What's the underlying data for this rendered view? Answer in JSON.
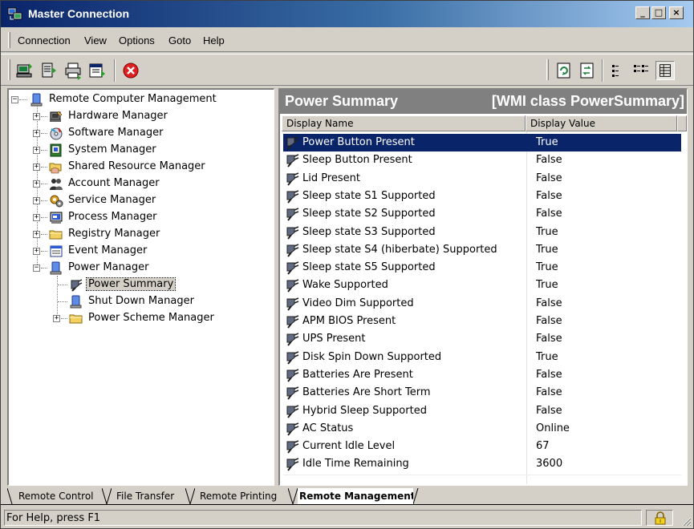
{
  "window": {
    "title": "Master Connection",
    "app_icon": "network-computer-icon",
    "controls": {
      "minimize": "_",
      "maximize": "□",
      "close": "×"
    }
  },
  "menubar": {
    "items": [
      "Connection",
      "View",
      "Options",
      "Goto",
      "Help"
    ]
  },
  "toolbar": {
    "left_buttons": [
      "connect-icon",
      "import-icon",
      "print-icon",
      "properties-icon",
      "stop-icon"
    ],
    "right_buttons": [
      "refresh-icon",
      "sync-icon",
      "small-icons-view-icon",
      "list-view-icon",
      "details-view-icon"
    ],
    "pressed": "details-view-icon"
  },
  "tree": {
    "root": {
      "label": "Remote Computer Management",
      "icon": "computer-icon"
    },
    "items": [
      {
        "label": "Hardware Manager",
        "icon": "hardware-icon"
      },
      {
        "label": "Software Manager",
        "icon": "software-icon"
      },
      {
        "label": "System Manager",
        "icon": "system-icon"
      },
      {
        "label": "Shared Resource Manager",
        "icon": "shared-folder-icon"
      },
      {
        "label": "Account Manager",
        "icon": "users-icon"
      },
      {
        "label": "Service Manager",
        "icon": "service-icon"
      },
      {
        "label": "Process Manager",
        "icon": "process-icon"
      },
      {
        "label": "Registry Manager",
        "icon": "folder-icon"
      },
      {
        "label": "Event Manager",
        "icon": "event-log-icon"
      },
      {
        "label": "Power Manager",
        "icon": "power-icon"
      }
    ],
    "power_children": [
      {
        "label": "Power Summary",
        "icon": "power-plug-icon",
        "selected": true
      },
      {
        "label": "Shut Down Manager",
        "icon": "shutdown-icon"
      },
      {
        "label": "Power Scheme Manager",
        "icon": "folder-icon"
      }
    ]
  },
  "panel": {
    "title": "Power Summary",
    "wmi_class": "[WMI class PowerSummary]",
    "columns": [
      "Display Name",
      "Display Value"
    ],
    "rows": [
      {
        "name": "Power Button Present",
        "value": "True"
      },
      {
        "name": "Sleep Button Present",
        "value": "False"
      },
      {
        "name": "Lid Present",
        "value": "False"
      },
      {
        "name": "Sleep state S1 Supported",
        "value": "False"
      },
      {
        "name": "Sleep state S2 Supported",
        "value": "False"
      },
      {
        "name": "Sleep state S3 Supported",
        "value": "True"
      },
      {
        "name": "Sleep state S4 (hiberbate) Supported",
        "value": "True"
      },
      {
        "name": "Sleep state S5 Supported",
        "value": "True"
      },
      {
        "name": "Wake Supported",
        "value": "True"
      },
      {
        "name": "Video Dim Supported",
        "value": "False"
      },
      {
        "name": "APM BIOS Present",
        "value": "False"
      },
      {
        "name": "UPS Present",
        "value": "False"
      },
      {
        "name": "Disk Spin Down Supported",
        "value": "True"
      },
      {
        "name": "Batteries Are Present",
        "value": "False"
      },
      {
        "name": "Batteries Are Short Term",
        "value": "False"
      },
      {
        "name": "Hybrid Sleep Supported",
        "value": "False"
      },
      {
        "name": "AC Status",
        "value": "Online"
      },
      {
        "name": "Current Idle Level",
        "value": "67"
      },
      {
        "name": "Idle Time Remaining",
        "value": "3600"
      }
    ],
    "selected_row": 0
  },
  "tabs": {
    "items": [
      "Remote Control",
      "File Transfer",
      "Remote Printing",
      "Remote Management"
    ],
    "active": "Remote Management"
  },
  "statusbar": {
    "text": "For Help, press F1",
    "lock_icon": "lock-icon"
  },
  "colors": {
    "titlebar_start": "#0a246a",
    "titlebar_end": "#a6caf0",
    "selection": "#0a246a",
    "panel_header": "#808080",
    "face": "#d4d0c8"
  }
}
